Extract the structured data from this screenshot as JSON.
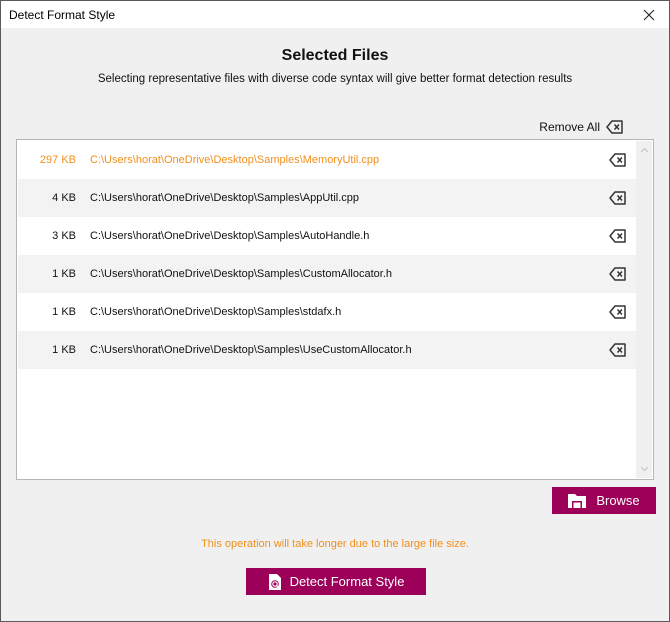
{
  "window": {
    "title": "Detect Format Style",
    "close_icon": "close-icon"
  },
  "header": {
    "title": "Selected Files",
    "subtitle": "Selecting representative files with diverse code syntax will give better format detection results"
  },
  "toolbar": {
    "remove_all_label": "Remove All",
    "remove_all_icon": "backspace-delete-icon"
  },
  "files": [
    {
      "size": "297 KB",
      "path": "C:\\Users\\horat\\OneDrive\\Desktop\\Samples\\MemoryUtil.cpp",
      "large": true
    },
    {
      "size": "4 KB",
      "path": "C:\\Users\\horat\\OneDrive\\Desktop\\Samples\\AppUtil.cpp",
      "large": false
    },
    {
      "size": "3 KB",
      "path": "C:\\Users\\horat\\OneDrive\\Desktop\\Samples\\AutoHandle.h",
      "large": false
    },
    {
      "size": "1 KB",
      "path": "C:\\Users\\horat\\OneDrive\\Desktop\\Samples\\CustomAllocator.h",
      "large": false
    },
    {
      "size": "1 KB",
      "path": "C:\\Users\\horat\\OneDrive\\Desktop\\Samples\\stdafx.h",
      "large": false
    },
    {
      "size": "1 KB",
      "path": "C:\\Users\\horat\\OneDrive\\Desktop\\Samples\\UseCustomAllocator.h",
      "large": false
    }
  ],
  "actions": {
    "browse_label": "Browse",
    "browse_icon": "folder-icon",
    "warning": "This operation will take longer due to the large file size.",
    "detect_label": "Detect Format Style",
    "detect_icon": "file-search-icon"
  },
  "colors": {
    "accent": "#9c0059",
    "warning": "#f0901e"
  }
}
